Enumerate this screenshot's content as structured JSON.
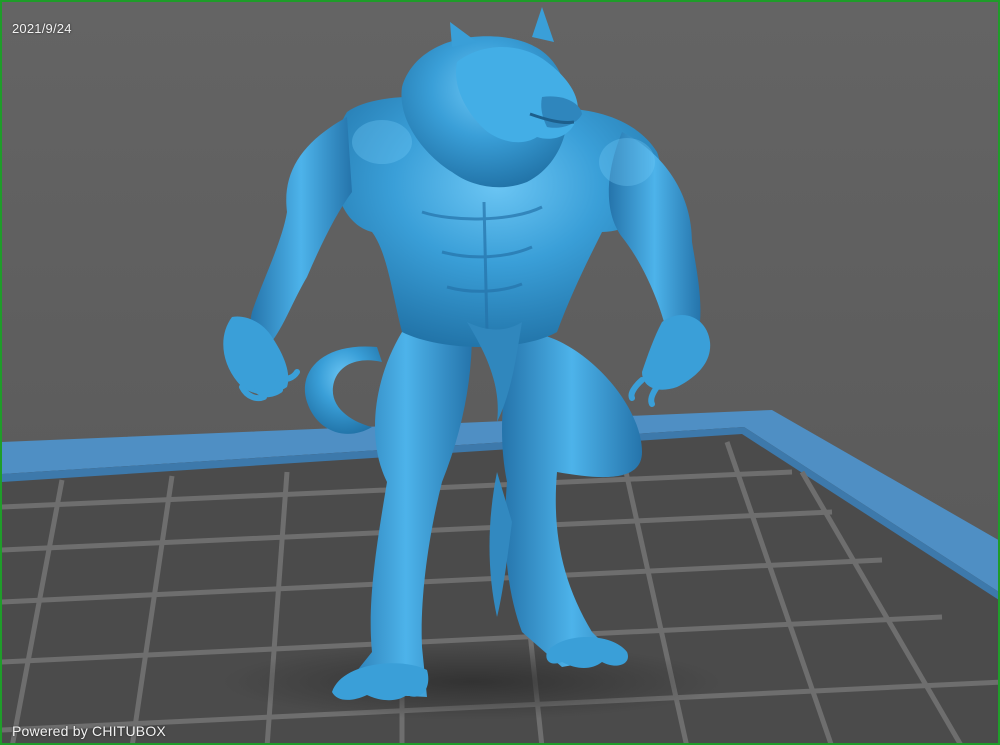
{
  "viewport": {
    "date_text": "2021/9/24",
    "brand_text": "Powered by CHITUBOX"
  },
  "scene": {
    "model_name": "werewolf-model",
    "model_color": "#3a9fd8",
    "plate_color": "#4b4b4b",
    "plate_edge_color": "#4f8fc4",
    "grid_line_color": "#6e6e6e",
    "border_color": "#1f9d2a"
  }
}
